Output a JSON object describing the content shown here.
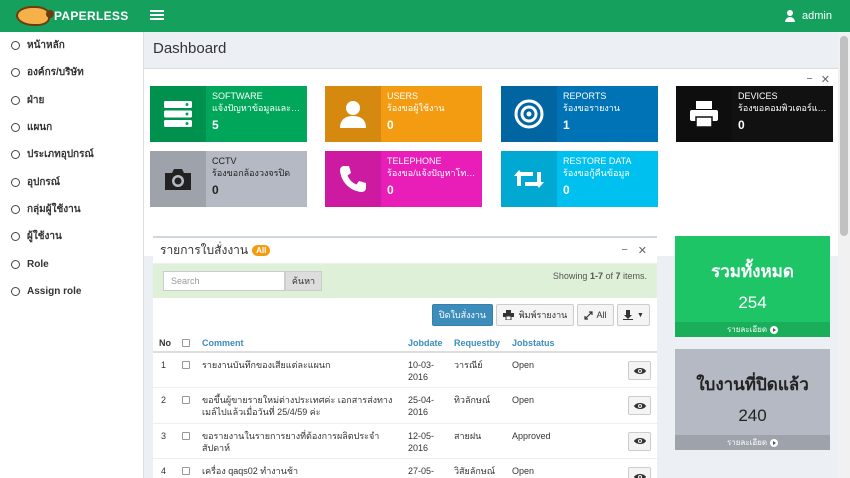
{
  "header": {
    "logo_text": "PAPERLESS",
    "user_name": "admin"
  },
  "sidebar": {
    "items": [
      {
        "label": "หน้าหลัก"
      },
      {
        "label": "องค์กร/บริษัท"
      },
      {
        "label": "ฝ่าย"
      },
      {
        "label": "แผนก"
      },
      {
        "label": "ประเภทอุปกรณ์"
      },
      {
        "label": "อุปกรณ์"
      },
      {
        "label": "กลุ่มผู้ใช้งาน"
      },
      {
        "label": "ผู้ใช้งาน"
      },
      {
        "label": "Role"
      },
      {
        "label": "Assign role"
      }
    ]
  },
  "page": {
    "title": "Dashboard"
  },
  "tiles": [
    {
      "title": "SOFTWARE",
      "sub": "แจ้งปัญหาข้อมูลและโปรแกรม",
      "count": "5",
      "color": "#00a65a",
      "icon": "server-icon"
    },
    {
      "title": "USERS",
      "sub": "ร้องขอผู้ใช้งาน",
      "count": "0",
      "color": "#f39c12",
      "icon": "user-icon"
    },
    {
      "title": "REPORTS",
      "sub": "ร้องขอรายงาน",
      "count": "1",
      "color": "#0073b7",
      "icon": "target-icon"
    },
    {
      "title": "DEVICES",
      "sub": "ร้องขอคอมพิวเตอร์และอุปกรณ์",
      "count": "0",
      "color": "#111111",
      "icon": "printer-icon"
    },
    {
      "title": "CCTV",
      "sub": "ร้องขอกล้องวงจรปิด",
      "count": "0",
      "color": "#b4b9c3",
      "icon": "camera-icon"
    },
    {
      "title": "TELEPHONE",
      "sub": "ร้องขอ/แจ้งปัญหาโทรศัพท์",
      "count": "0",
      "color": "#e91eb8",
      "icon": "phone-icon"
    },
    {
      "title": "RESTORE DATA",
      "sub": "ร้องขอกู้คืนข้อมูล",
      "count": "0",
      "color": "#00c0ef",
      "icon": "retweet-icon"
    }
  ],
  "jobs": {
    "title": "รายการใบสั่งงาน",
    "badge": "All",
    "search_placeholder": "Search",
    "search_button": "ค้นหา",
    "showing_prefix": "Showing ",
    "showing_range": "1-7",
    "showing_of": " of ",
    "showing_total": "7",
    "showing_suffix": " items.",
    "close_job_button": "ปิดใบสั่งงาน",
    "print_button": "พิมพ์รายงาน",
    "all_button": "All",
    "columns": [
      "No",
      "Comment",
      "Jobdate",
      "Requestby",
      "Jobstatus"
    ],
    "rows": [
      {
        "no": "1",
        "comment": "รายงานบันทึกของเสียแต่ละแผนก",
        "jobdate": "10-03-2016",
        "requestby": "วารณีย์",
        "status": "Open"
      },
      {
        "no": "2",
        "comment": "ขอขึ้นผู้ขายรายใหม่ต่างประเทศค่ะ เอกสารส่งทางเมล์ไปแล้วเมื่อวันที่ 25/4/59 ค่ะ",
        "jobdate": "25-04-2016",
        "requestby": "ทิวลักษณ์",
        "status": "Open"
      },
      {
        "no": "3",
        "comment": "ขอรายงานในรายการยางที่ต้องการผลิตประจำสัปดาห์",
        "jobdate": "12-05-2016",
        "requestby": "สายฝน",
        "status": "Approved"
      },
      {
        "no": "4",
        "comment": "เครื่อง qaqs02 ทำงานช้า",
        "jobdate": "27-05-",
        "requestby": "วิสัยลักษณ์",
        "status": "Open"
      }
    ]
  },
  "summary": {
    "total_title": "รวมทั้งหมด",
    "total_value": "254",
    "total_link": "รายละเอียด",
    "closed_title": "ใบงานที่ปิดแล้ว",
    "closed_value": "240",
    "closed_link": "รายละเอียด"
  }
}
